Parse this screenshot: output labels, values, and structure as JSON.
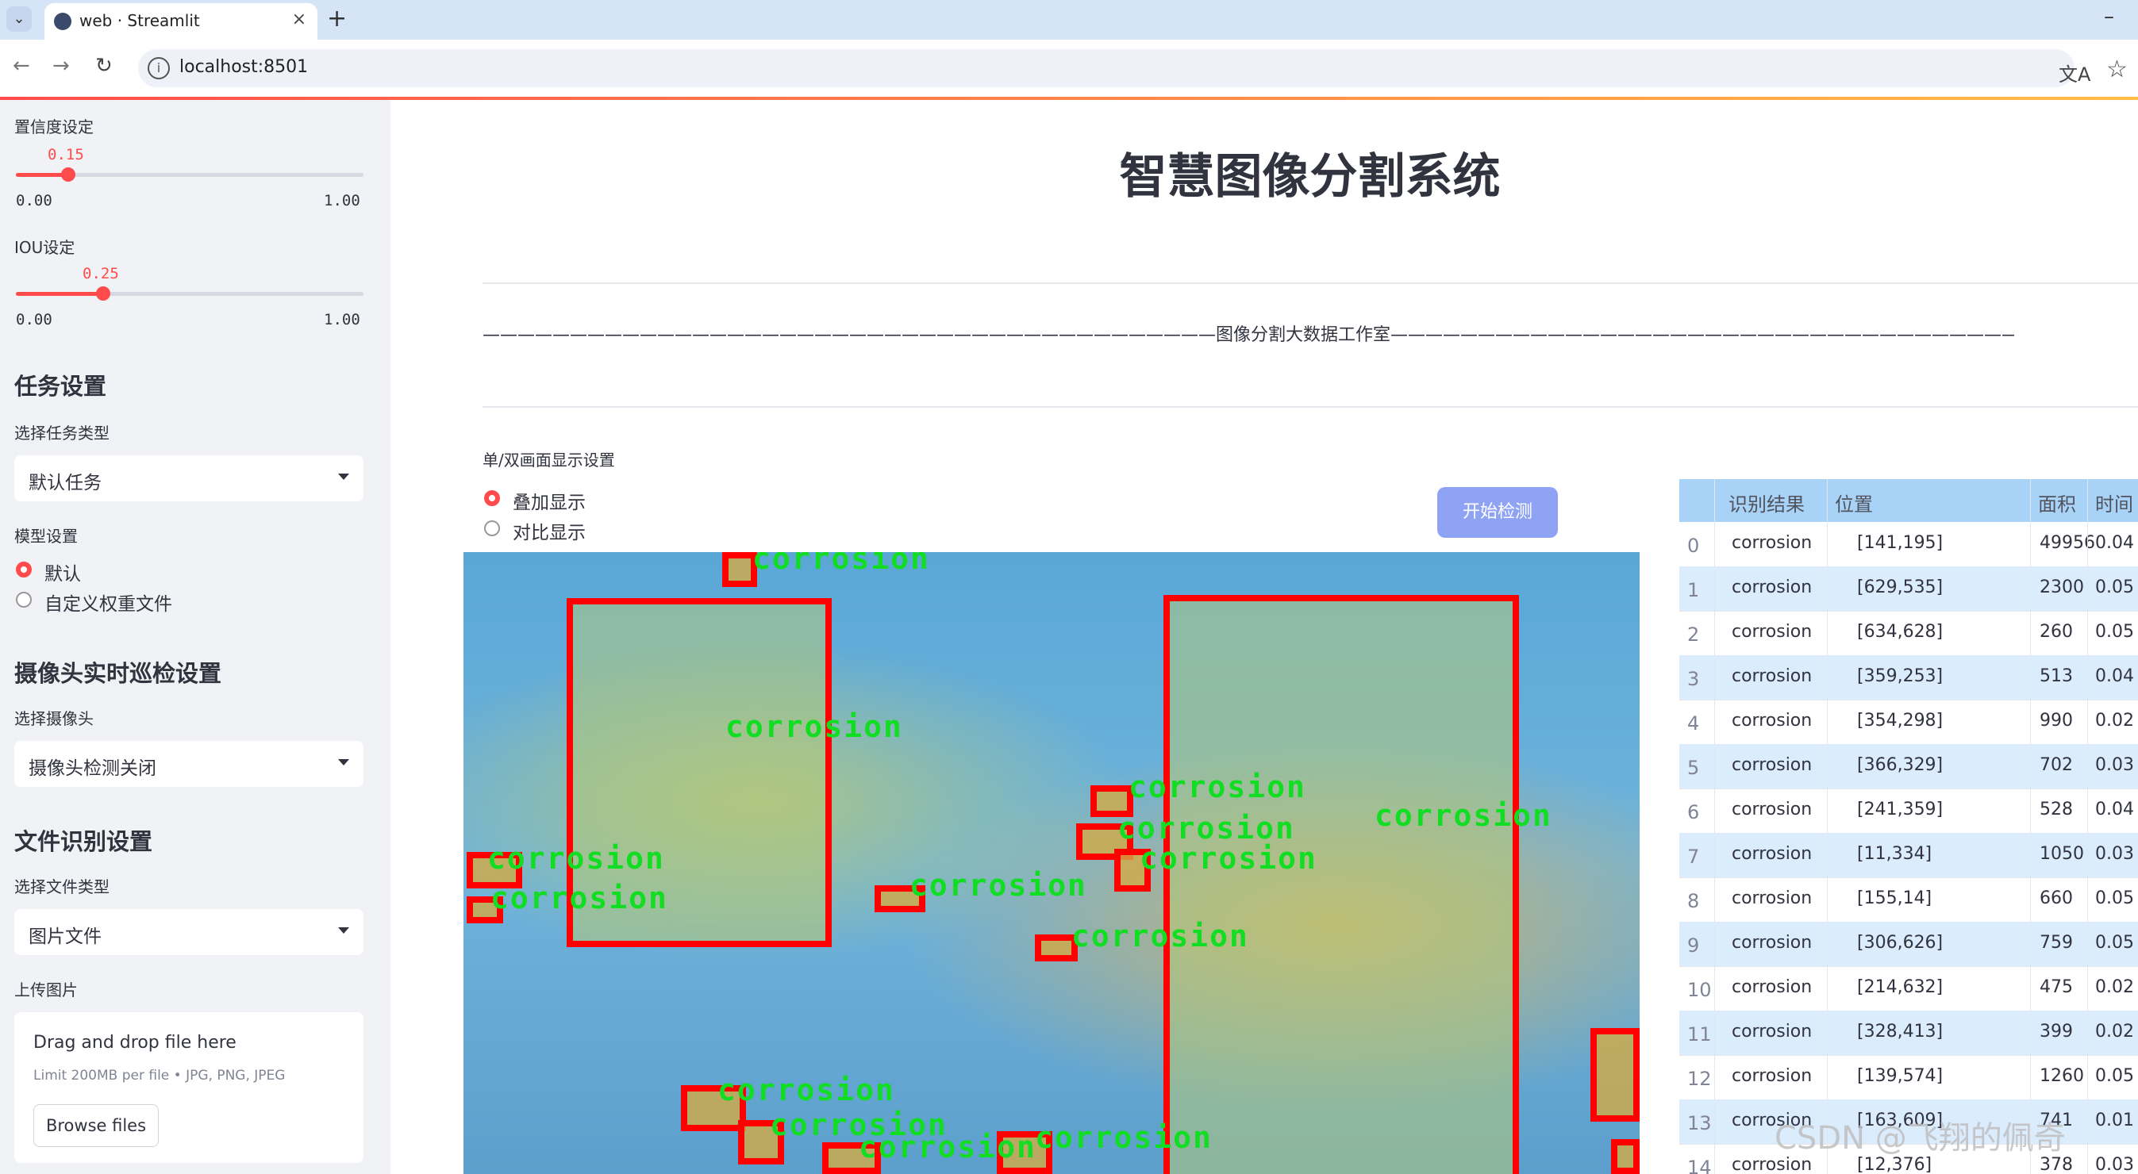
{
  "browser": {
    "tab_title": "web · Streamlit",
    "tab_close": "×",
    "new_tab": "+",
    "minimize": "–",
    "url": "localhost:8501"
  },
  "sidebar": {
    "confidence": {
      "label": "置信度设定",
      "value": "0.15",
      "value_fraction": 0.15,
      "min": "0.00",
      "max": "1.00"
    },
    "iou": {
      "label": "IOU设定",
      "value": "0.25",
      "value_fraction": 0.25,
      "min": "0.00",
      "max": "1.00"
    },
    "task": {
      "heading": "任务设置",
      "select_label": "选择任务类型",
      "selected": "默认任务"
    },
    "model": {
      "label": "模型设置",
      "options": [
        "默认",
        "自定义权重文件"
      ],
      "selected_index": 0
    },
    "camera": {
      "heading": "摄像头实时巡检设置",
      "select_label": "选择摄像头",
      "selected": "摄像头检测关闭"
    },
    "file": {
      "heading": "文件识别设置",
      "select_label": "选择文件类型",
      "selected": "图片文件"
    },
    "upload": {
      "label": "上传图片",
      "drop_text": "Drag and drop file here",
      "limit_text": "Limit 200MB per file • JPG, PNG, JPEG",
      "browse_label": "Browse files"
    }
  },
  "main": {
    "title": "智慧图像分割系统",
    "divider_text": "——————————————————————————————————————————图像分割大数据工作室——————————————————————————————————————————",
    "display_mode": {
      "label": "单/双画面显示设置",
      "options": [
        "叠加显示",
        "对比显示"
      ],
      "selected_index": 0
    },
    "start_button": "开始检测",
    "detection_label": "corrosion"
  },
  "table": {
    "columns": [
      "识别结果",
      "位置",
      "面积",
      "时间"
    ],
    "rows": [
      {
        "idx": "0",
        "result": "corrosion",
        "pos": "[141,195]",
        "area": "49956",
        "time": "0.04"
      },
      {
        "idx": "1",
        "result": "corrosion",
        "pos": "[629,535]",
        "area": "2300",
        "time": "0.05"
      },
      {
        "idx": "2",
        "result": "corrosion",
        "pos": "[634,628]",
        "area": "260",
        "time": "0.05"
      },
      {
        "idx": "3",
        "result": "corrosion",
        "pos": "[359,253]",
        "area": "513",
        "time": "0.04"
      },
      {
        "idx": "4",
        "result": "corrosion",
        "pos": "[354,298]",
        "area": "990",
        "time": "0.02"
      },
      {
        "idx": "5",
        "result": "corrosion",
        "pos": "[366,329]",
        "area": "702",
        "time": "0.03"
      },
      {
        "idx": "6",
        "result": "corrosion",
        "pos": "[241,359]",
        "area": "528",
        "time": "0.04"
      },
      {
        "idx": "7",
        "result": "corrosion",
        "pos": "[11,334]",
        "area": "1050",
        "time": "0.03"
      },
      {
        "idx": "8",
        "result": "corrosion",
        "pos": "[155,14]",
        "area": "660",
        "time": "0.05"
      },
      {
        "idx": "9",
        "result": "corrosion",
        "pos": "[306,626]",
        "area": "759",
        "time": "0.05"
      },
      {
        "idx": "10",
        "result": "corrosion",
        "pos": "[214,632]",
        "area": "475",
        "time": "0.02"
      },
      {
        "idx": "11",
        "result": "corrosion",
        "pos": "[328,413]",
        "area": "399",
        "time": "0.02"
      },
      {
        "idx": "12",
        "result": "corrosion",
        "pos": "[139,574]",
        "area": "1260",
        "time": "0.05"
      },
      {
        "idx": "13",
        "result": "corrosion",
        "pos": "[163,609]",
        "area": "741",
        "time": "0.01"
      },
      {
        "idx": "14",
        "result": "corrosion",
        "pos": "[12,376]",
        "area": "378",
        "time": "0.03"
      }
    ]
  },
  "watermark": "CSDN @飞翔的佩奇",
  "colors": {
    "accent": "#ff4b4b",
    "button": "#8fa3f5",
    "table_header": "#a9d2f7",
    "table_alt_row": "#dbecfd",
    "detection_box": "#ff0000",
    "detection_text": "#11dd22"
  }
}
